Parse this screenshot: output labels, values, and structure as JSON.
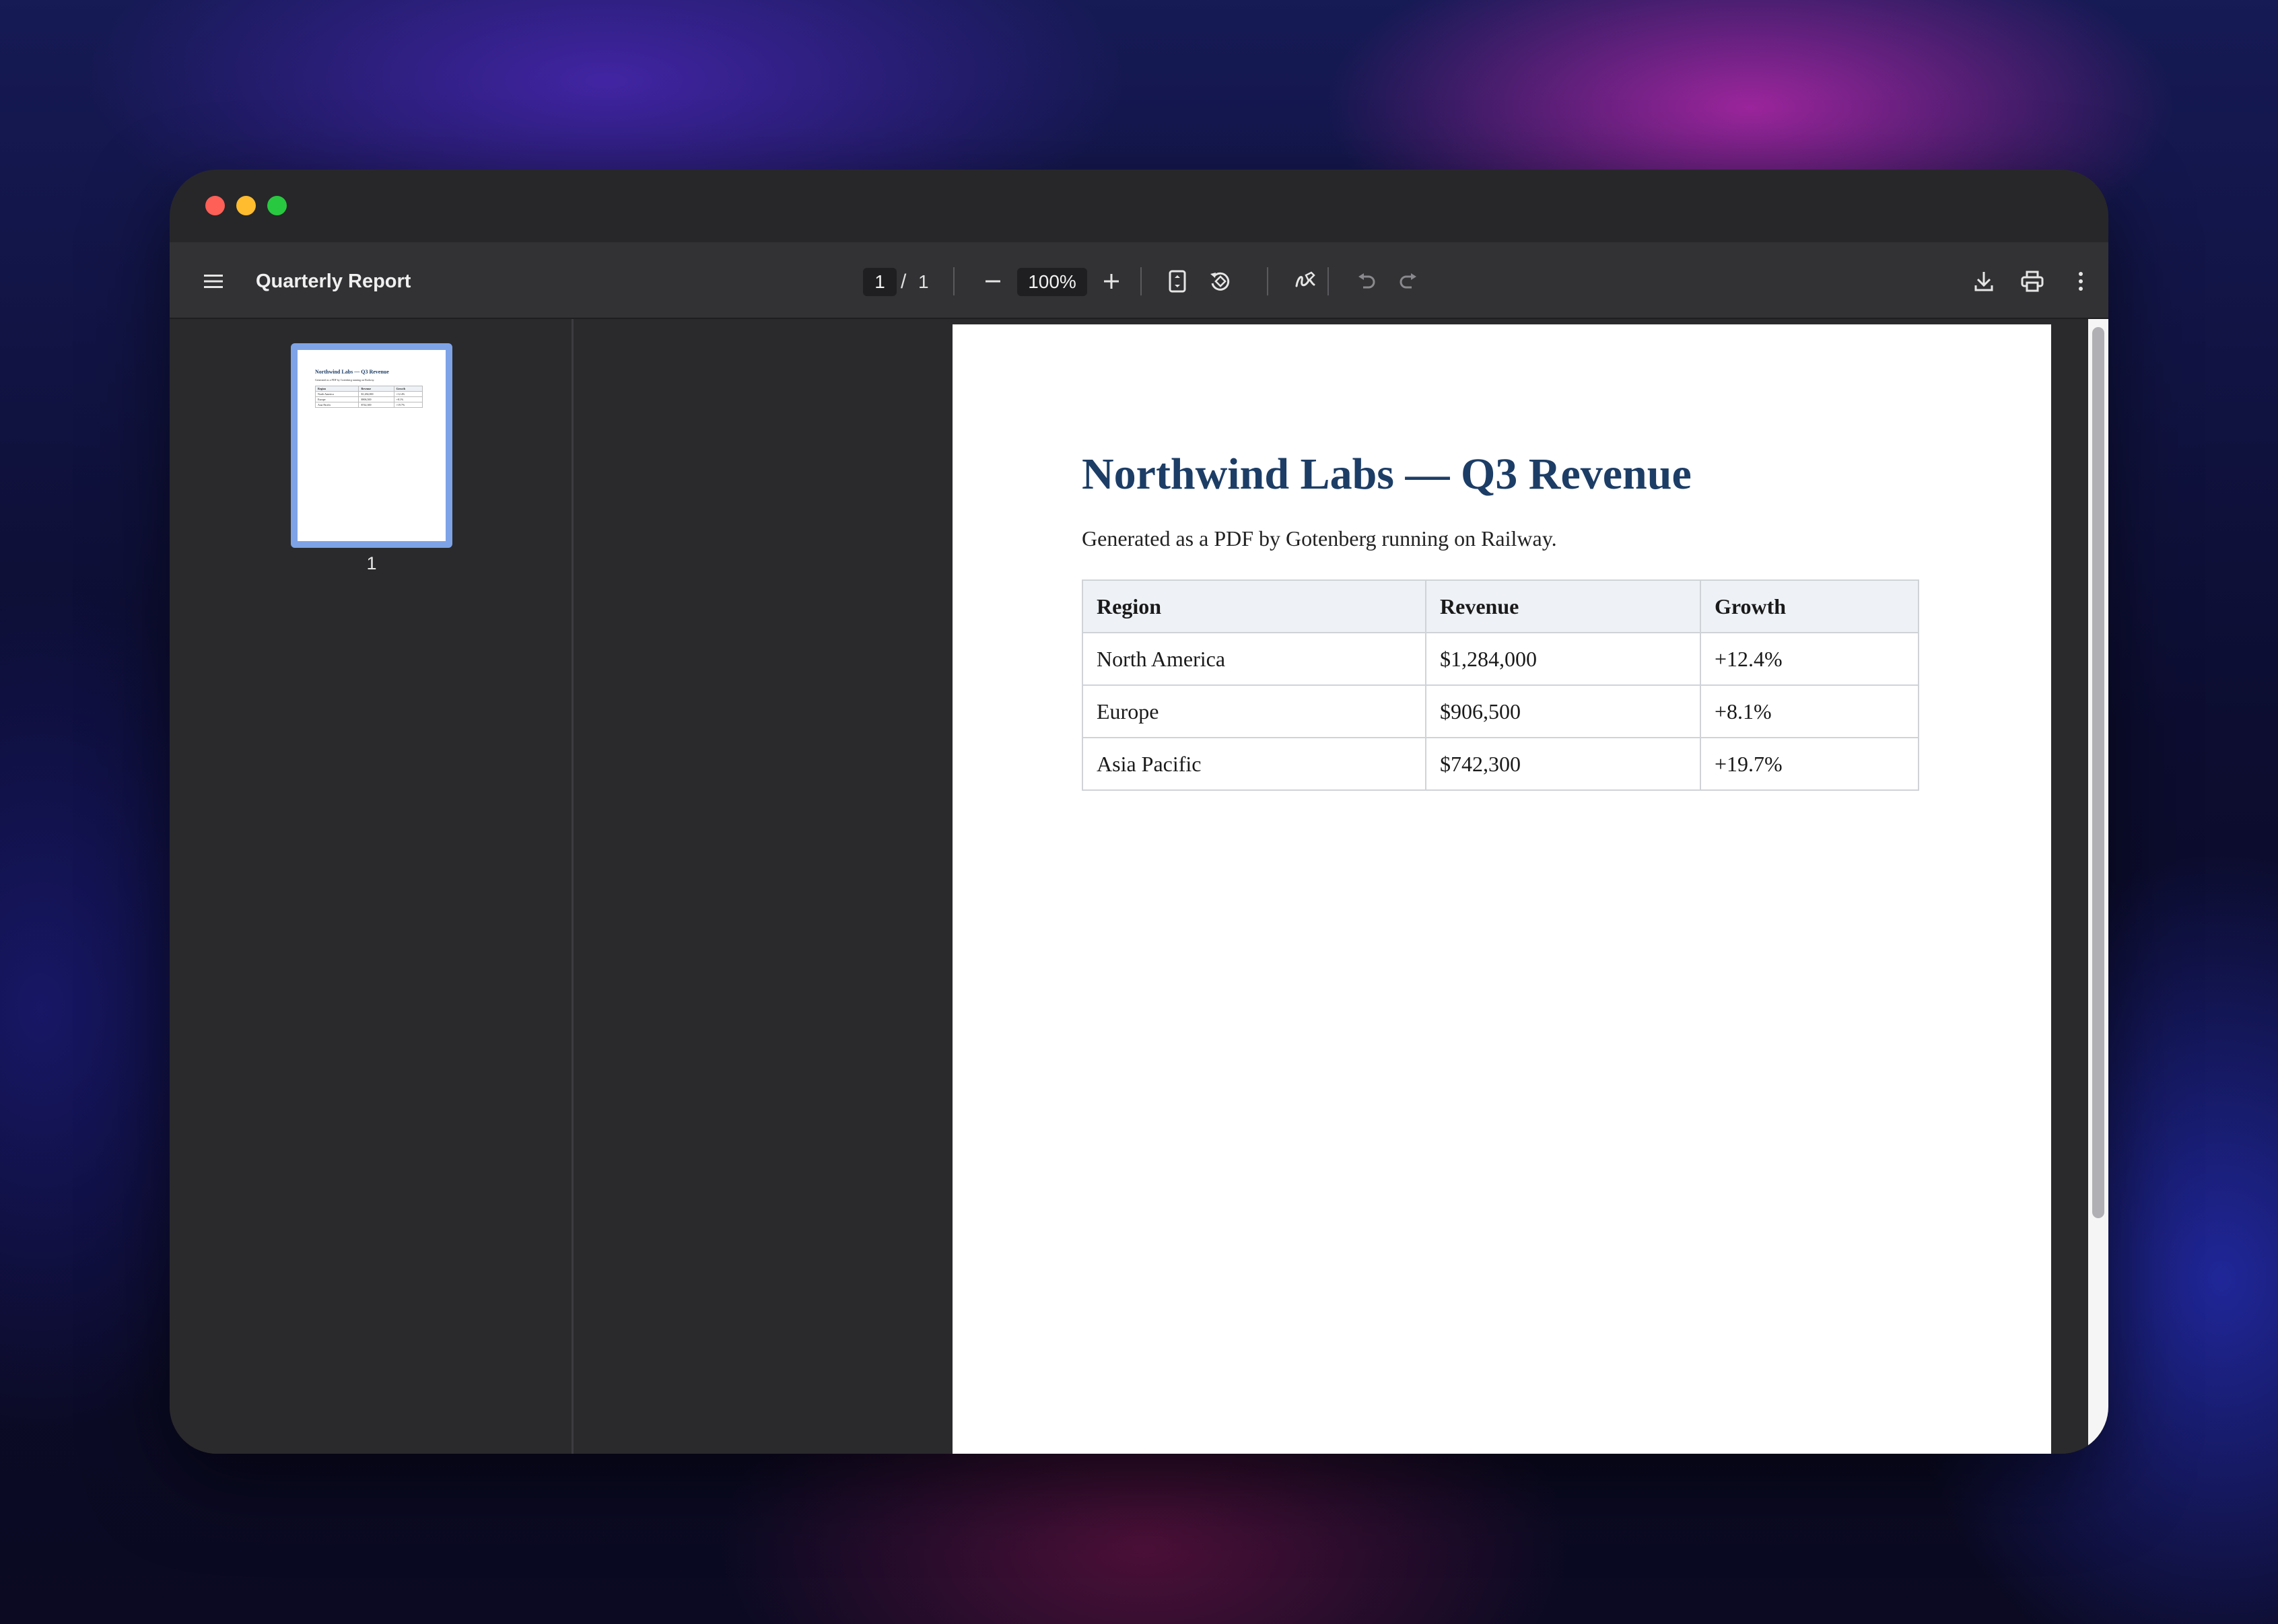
{
  "toolbar": {
    "title": "Quarterly Report",
    "page_current": "1",
    "page_separator": "/",
    "page_total": "1",
    "zoom": "100%"
  },
  "sidebar": {
    "thumbnails": [
      {
        "label": "1"
      }
    ]
  },
  "document": {
    "title": "Northwind Labs — Q3 Revenue",
    "subtitle": "Generated as a PDF by Gotenberg running on Railway.",
    "table": {
      "headers": [
        "Region",
        "Revenue",
        "Growth"
      ],
      "rows": [
        [
          "North America",
          "$1,284,000",
          "+12.4%"
        ],
        [
          "Europe",
          "$906,500",
          "+8.1%"
        ],
        [
          "Asia Pacific",
          "$742,300",
          "+19.7%"
        ]
      ]
    }
  },
  "icons": {
    "menu": "menu-icon",
    "zoom_out": "minus-icon",
    "zoom_in": "plus-icon",
    "fit": "fit-page-icon",
    "rotate": "rotate-icon",
    "annotate": "draw-icon",
    "undo": "undo-icon",
    "redo": "redo-icon",
    "download": "download-icon",
    "print": "print-icon",
    "more": "more-vertical-icon"
  },
  "colors": {
    "title": "#1c3d66",
    "thumbnail_border": "#7ea3e6",
    "toolbar": "#323234"
  }
}
